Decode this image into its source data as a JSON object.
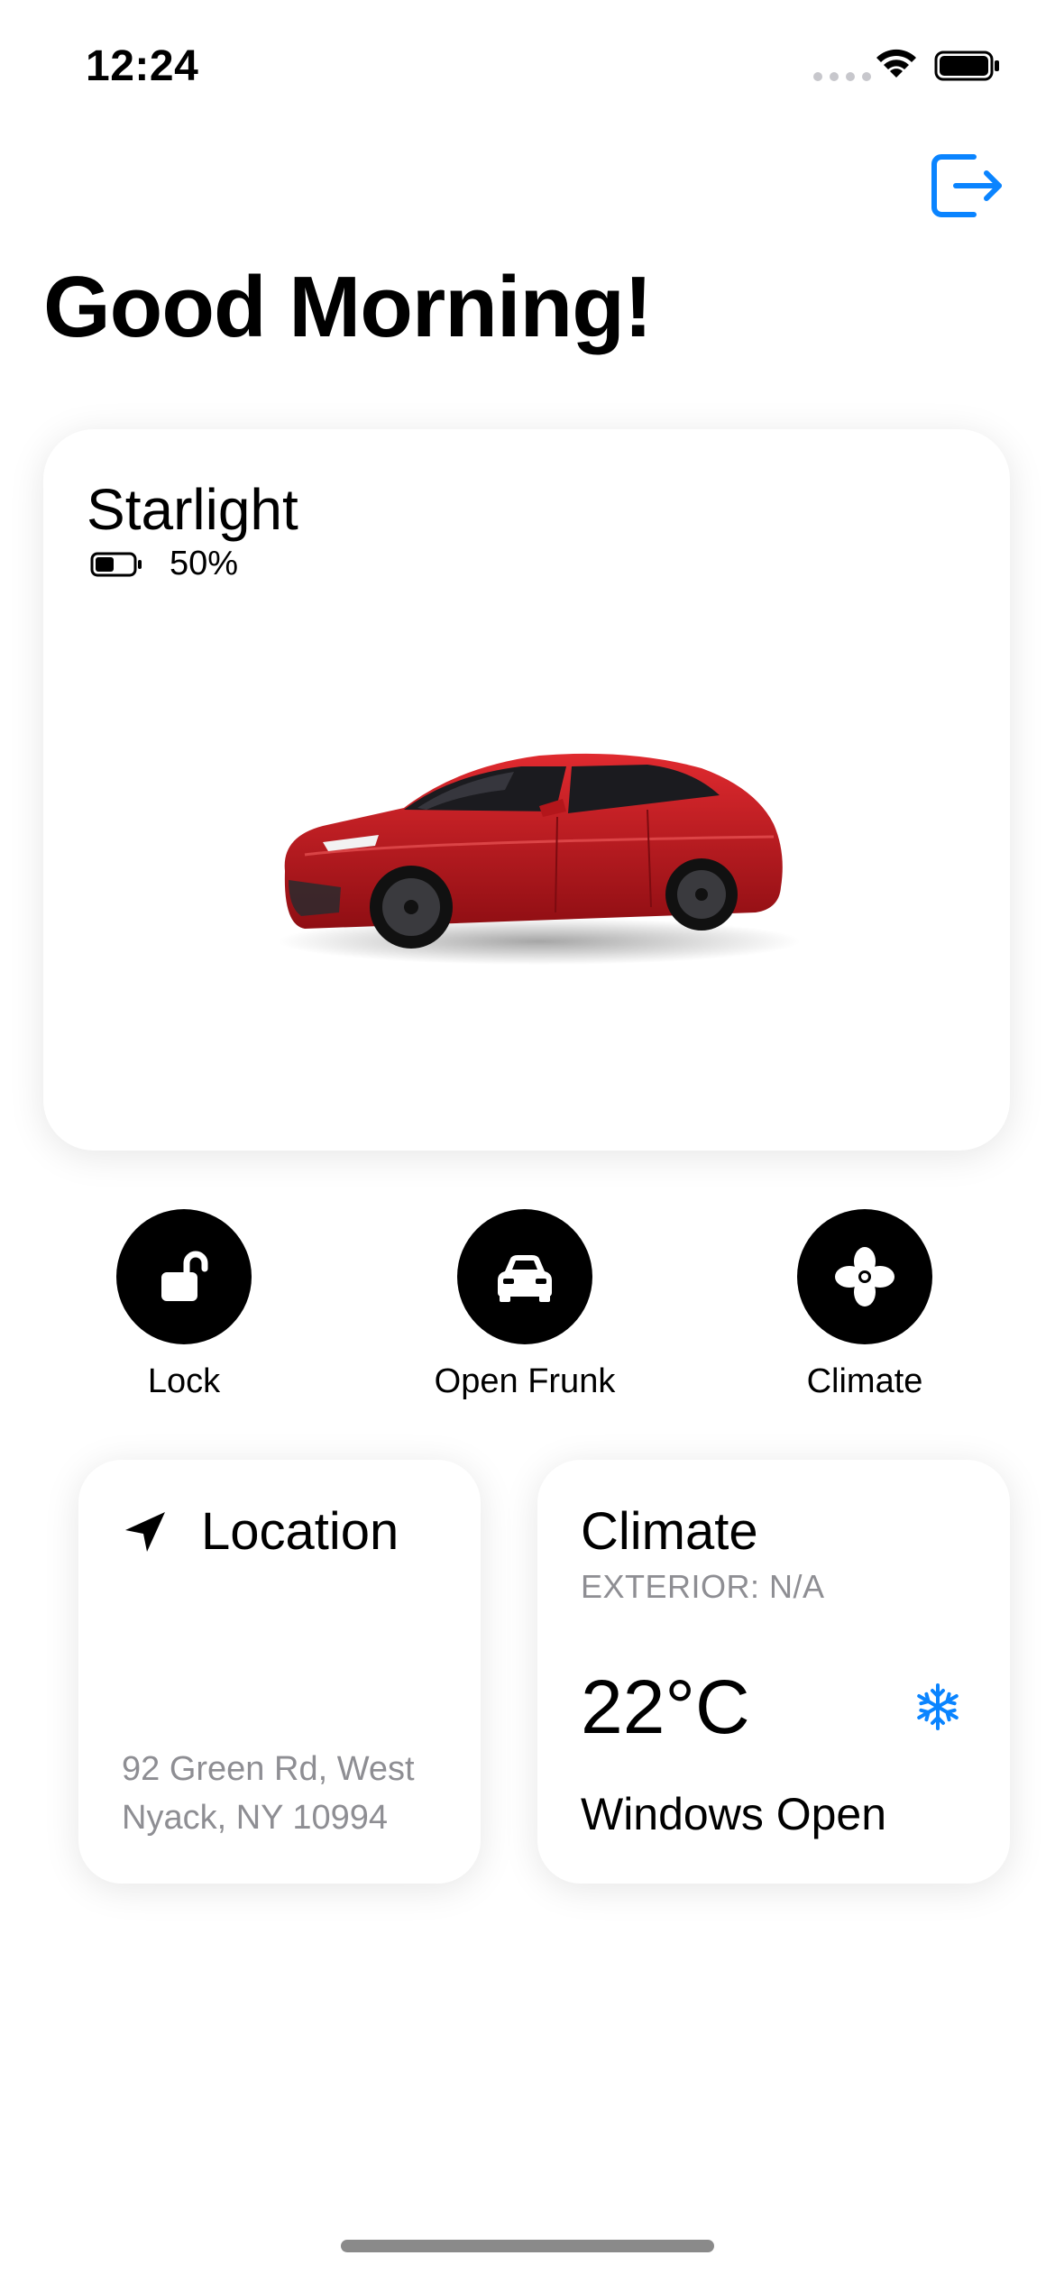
{
  "status_bar": {
    "time": "12:24"
  },
  "header": {
    "greeting": "Good Morning!",
    "signout_icon": "sign-out-icon"
  },
  "vehicle": {
    "name": "Starlight",
    "charge": "50%",
    "charge_level": 0.5,
    "color": "#c4161c"
  },
  "actions": [
    {
      "label": "Lock",
      "icon": "unlock-icon"
    },
    {
      "label": "Open Frunk",
      "icon": "car-front-icon"
    },
    {
      "label": "Climate",
      "icon": "fan-icon"
    }
  ],
  "location_card": {
    "title": "Location",
    "icon": "location-arrow-icon",
    "address_line1": "92 Green Rd, West",
    "address_line2": "Nyack, NY 10994"
  },
  "climate_card": {
    "title": "Climate",
    "exterior": "EXTERIOR: N/A",
    "temperature": "22°C",
    "windows": "Windows Open",
    "icon": "snowflake-icon"
  },
  "colors": {
    "accent": "#0a84ff",
    "text": "#000000",
    "secondary_text": "#8e8e93"
  }
}
